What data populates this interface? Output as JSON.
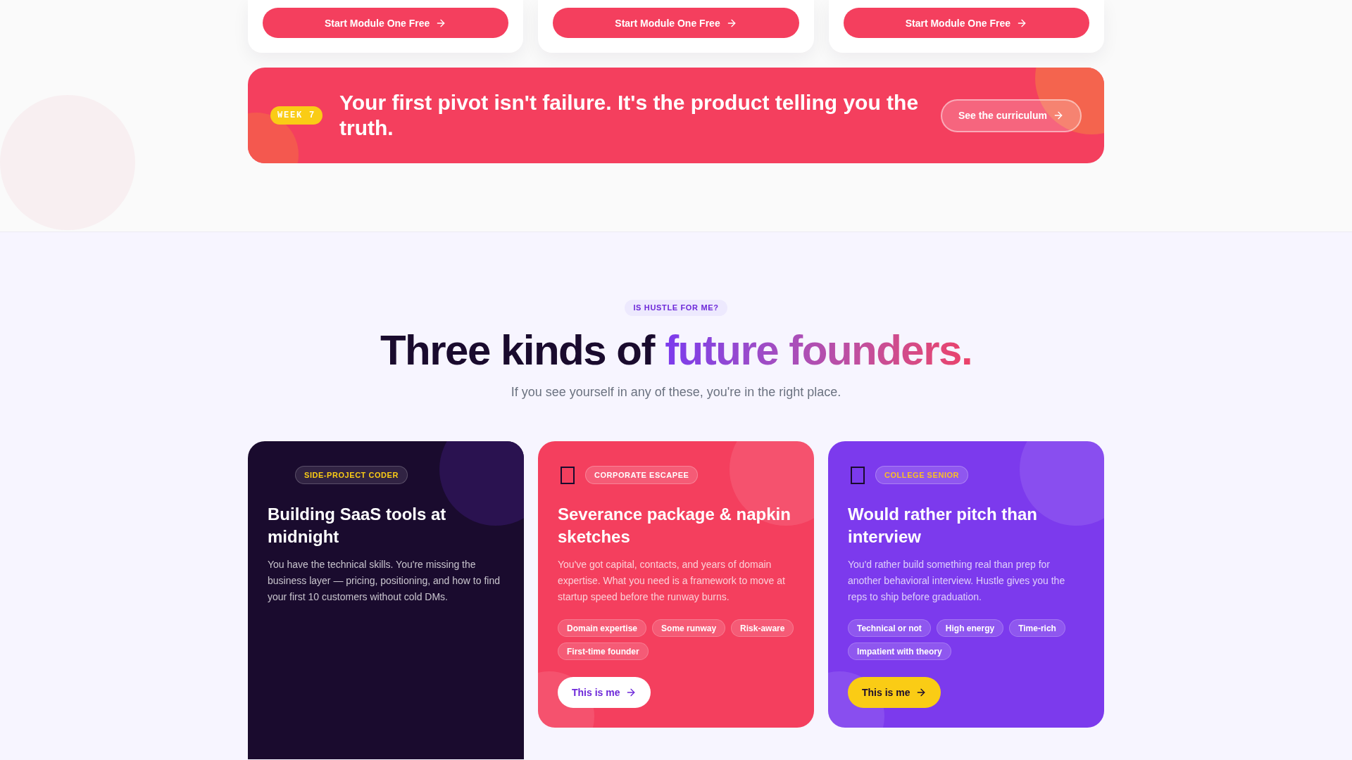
{
  "module_cards": [
    {
      "button": "Start Module One Free"
    },
    {
      "button": "Start Module One Free"
    },
    {
      "button": "Start Module One Free"
    }
  ],
  "banner": {
    "badge": "WEEK 7",
    "headline": "Your first pivot isn't failure. It's the product telling you the truth.",
    "button": "See the curriculum"
  },
  "section": {
    "eyebrow": "IS HUSTLE FOR ME?",
    "heading": "Three kinds of",
    "heading_highlight": "future founders.",
    "subtitle": "If you see yourself in any of these, you're in the right place."
  },
  "personas": [
    {
      "kind": "dark",
      "tag": "SIDE-PROJECT CODER",
      "title": "Building SaaS tools at midnight",
      "description": "You have the technical skills. You're missing the business layer — pricing, positioning, and how to find your first 10 customers without cold DMs."
    },
    {
      "kind": "coral",
      "tag": "CORPORATE ESCAPEE",
      "title": "Severance package & napkin sketches",
      "description": "You've got capital, contacts, and years of domain expertise. What you need is a framework to move at startup speed before the runway burns.",
      "traits": [
        "Domain expertise",
        "Some runway",
        "Risk-aware",
        "First-time founder"
      ],
      "button": "This is me"
    },
    {
      "kind": "violet",
      "tag": "COLLEGE SENIOR",
      "title": "Would rather pitch than interview",
      "description": "You'd rather build something real than prep for another behavioral interview. Hustle gives you the reps to ship before graduation.",
      "traits": [
        "Technical or not",
        "High energy",
        "Time-rich",
        "Impatient with theory"
      ],
      "button": "This is me"
    }
  ]
}
